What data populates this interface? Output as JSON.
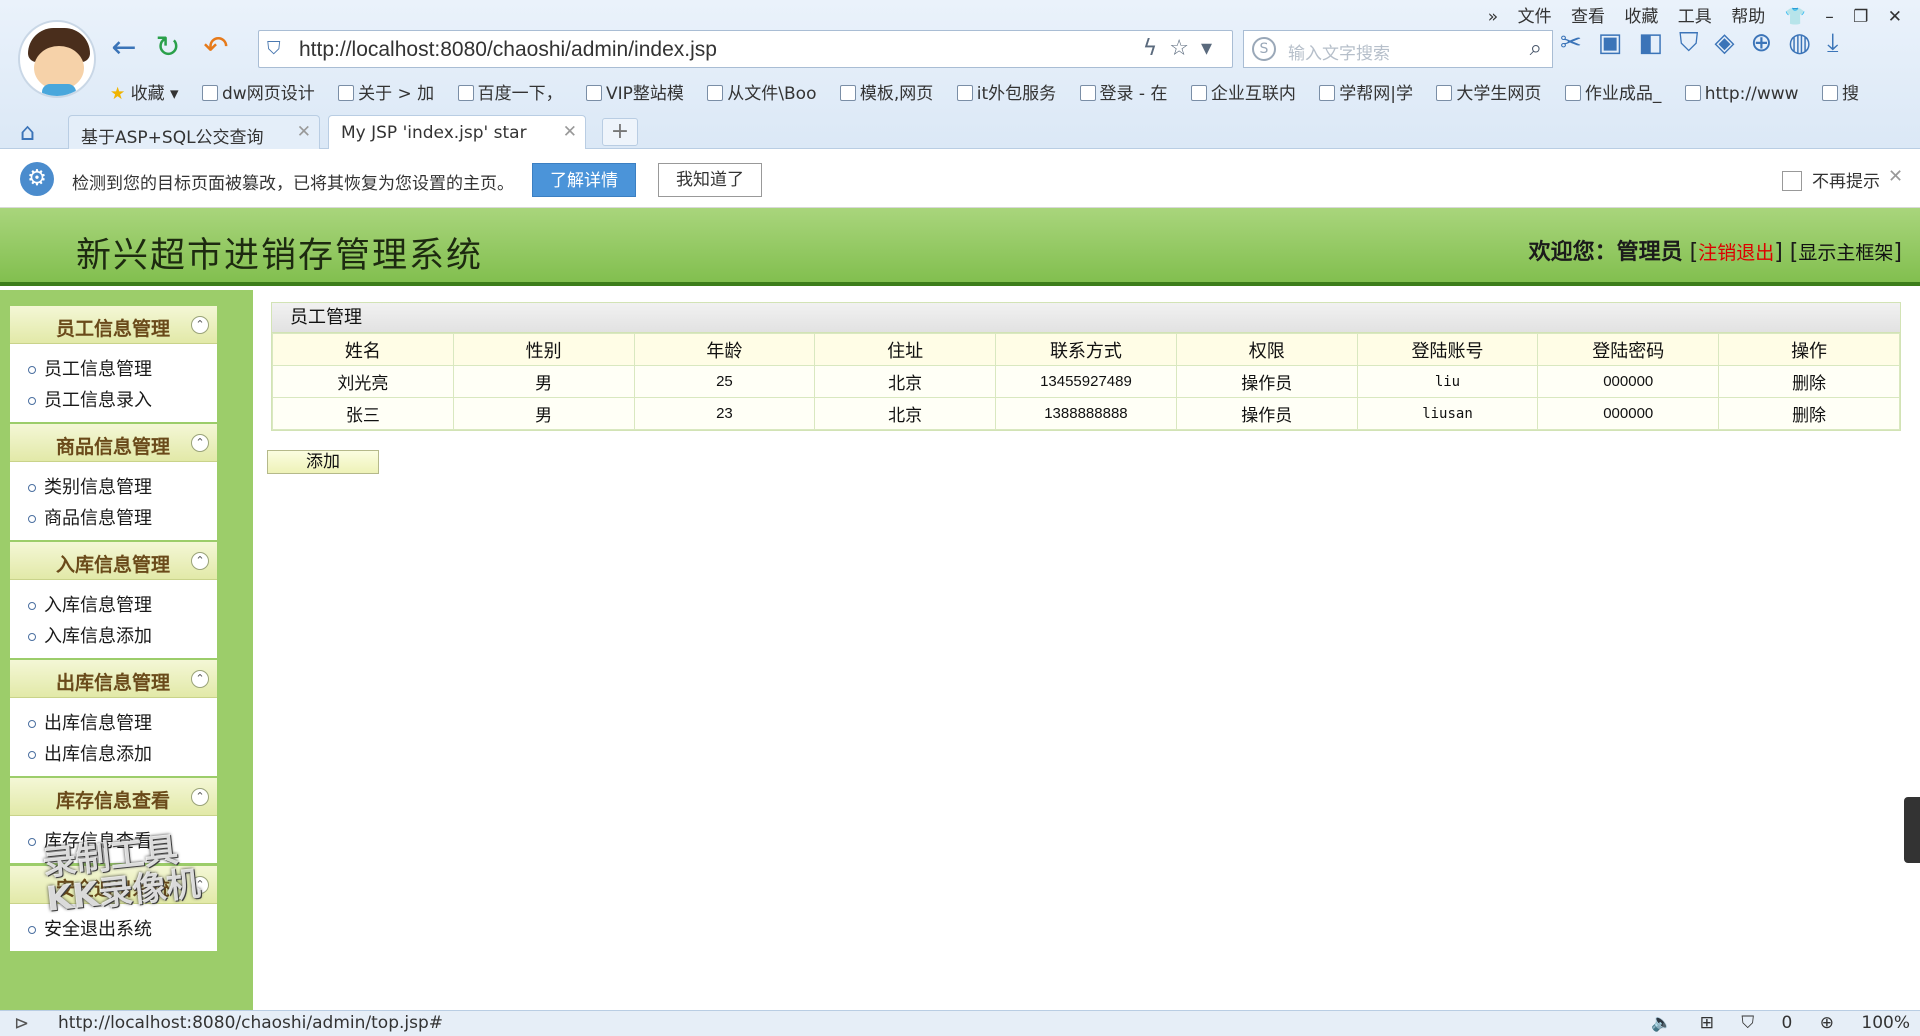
{
  "browser": {
    "url": "http://localhost:8080/chaoshi/admin/index.jsp",
    "search_placeholder": "输入文字搜索",
    "top_menu": [
      "文件",
      "查看",
      "收藏",
      "工具",
      "帮助"
    ],
    "bookmarks": [
      "收藏",
      "dw网页设计",
      "关于 > 加",
      "百度一下，",
      "VIP整站模",
      "从文件\\Boo",
      "模板,网页",
      "it外包服务",
      "登录 - 在",
      "企业互联内",
      "学帮网|学",
      "大学生网页",
      "作业成品_",
      "http://www",
      "搜"
    ],
    "tabs": [
      {
        "label": "基于ASP+SQL公交查询"
      },
      {
        "label": "My JSP 'index.jsp' star"
      }
    ],
    "new_tab": "+"
  },
  "notification": {
    "message": "检测到您的目标页面被篡改，已将其恢复为您设置的主页。",
    "details_button": "了解详情",
    "got_it_button": "我知道了",
    "dont_remind": "不再提示"
  },
  "header": {
    "title": "新兴超市进销存管理系统",
    "welcome": "欢迎您：管理员",
    "logout": "注销退出",
    "show_frame": "显示主框架"
  },
  "sidebar": {
    "groups": [
      {
        "title": "员工信息管理",
        "items": [
          "员工信息管理",
          "员工信息录入"
        ]
      },
      {
        "title": "商品信息管理",
        "items": [
          "类别信息管理",
          "商品信息管理"
        ]
      },
      {
        "title": "入库信息管理",
        "items": [
          "入库信息管理",
          "入库信息添加"
        ]
      },
      {
        "title": "出库信息管理",
        "items": [
          "出库信息管理",
          "出库信息添加"
        ]
      },
      {
        "title": "库存信息查看",
        "items": [
          "库存信息查看"
        ]
      },
      {
        "title": "安全退出系统",
        "items": [
          "安全退出系统"
        ]
      }
    ]
  },
  "main": {
    "panel_title": "员工管理",
    "columns": [
      "姓名",
      "性别",
      "年龄",
      "住址",
      "联系方式",
      "权限",
      "登陆账号",
      "登陆密码",
      "操作"
    ],
    "rows": [
      [
        "刘光亮",
        "男",
        "25",
        "北京",
        "13455927489",
        "操作员",
        "liu",
        "000000",
        "删除"
      ],
      [
        "张三",
        "男",
        "23",
        "北京",
        "1388888888",
        "操作员",
        "liusan",
        "000000",
        "删除"
      ]
    ],
    "add_button": "添加"
  },
  "watermark": {
    "line1": "录制工具",
    "line2": "KK录像机"
  },
  "statusbar": {
    "url": "http://localhost:8080/chaoshi/admin/top.jsp#",
    "count": "0",
    "zoom": "100%"
  }
}
